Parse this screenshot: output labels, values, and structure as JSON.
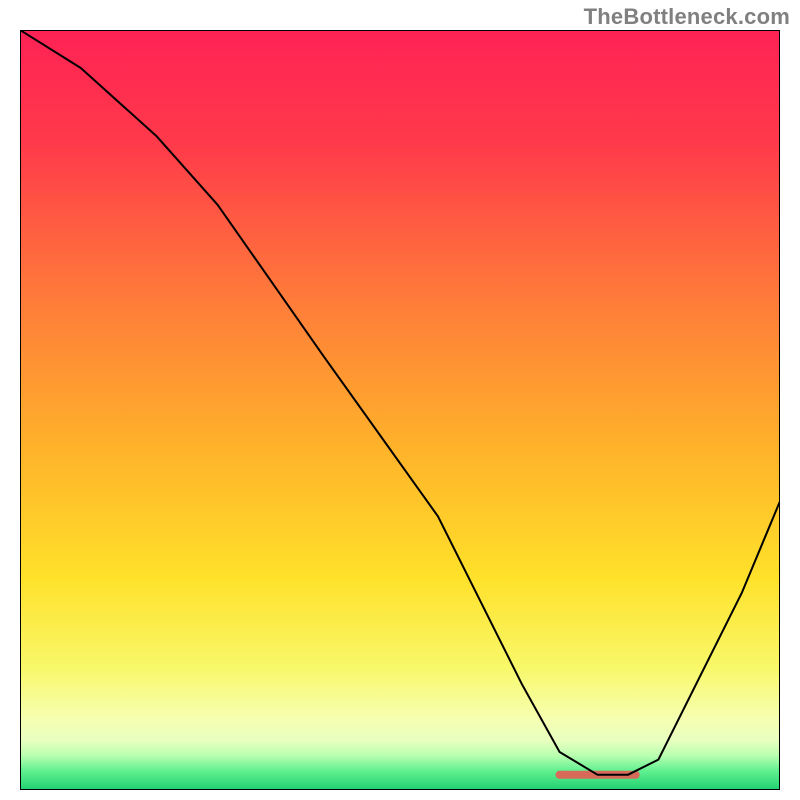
{
  "watermark": "TheBottleneck.com",
  "chart_data": {
    "type": "line",
    "title": "",
    "xlabel": "",
    "ylabel": "",
    "xlim": [
      0,
      100
    ],
    "ylim": [
      0,
      100
    ],
    "show_axes": false,
    "show_grid": false,
    "gradient_stops": [
      {
        "offset": 0.0,
        "color": "#ff2255"
      },
      {
        "offset": 0.15,
        "color": "#ff3a4a"
      },
      {
        "offset": 0.35,
        "color": "#ff7a3a"
      },
      {
        "offset": 0.55,
        "color": "#ffb22a"
      },
      {
        "offset": 0.72,
        "color": "#ffe12a"
      },
      {
        "offset": 0.84,
        "color": "#f8f86a"
      },
      {
        "offset": 0.905,
        "color": "#f6ffb0"
      },
      {
        "offset": 0.935,
        "color": "#e8ffc0"
      },
      {
        "offset": 0.955,
        "color": "#b8ffb0"
      },
      {
        "offset": 0.975,
        "color": "#60f090"
      },
      {
        "offset": 1.0,
        "color": "#20d070"
      }
    ],
    "series": [
      {
        "name": "bottleneck-curve",
        "color": "#000000",
        "stroke_width": 2,
        "x": [
          0,
          8,
          18,
          26,
          40,
          55,
          66,
          71,
          76,
          80,
          84,
          95,
          100
        ],
        "values": [
          100,
          95,
          86,
          77,
          57,
          36,
          14,
          5,
          2,
          2,
          4,
          26,
          38
        ]
      }
    ],
    "optimal_marker": {
      "x_start": 71,
      "x_end": 81,
      "y": 2,
      "color": "#d86a5a",
      "radius": 4
    }
  }
}
